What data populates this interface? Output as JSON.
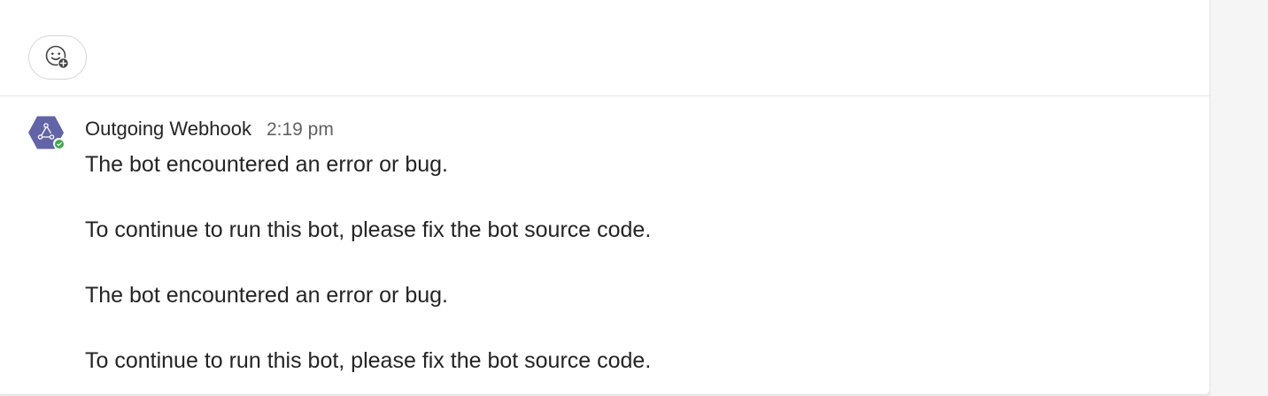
{
  "reaction": {
    "icon": "add-reaction-icon"
  },
  "message": {
    "sender": "Outgoing Webhook",
    "time": "2:19 pm",
    "avatar_icon": "webhook-icon",
    "avatar_color": "#6264a7",
    "status": "available",
    "status_color": "#40a84f",
    "lines": [
      "The bot encountered an error or bug.",
      "To continue to run this bot, please fix the bot source code.",
      "The bot encountered an error or bug.",
      "To continue to run this bot, please fix the bot source code."
    ]
  }
}
